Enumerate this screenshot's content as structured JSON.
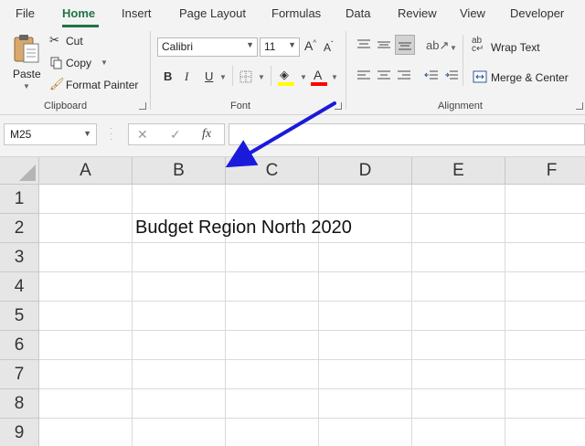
{
  "tabs": [
    {
      "label": "File",
      "active": false
    },
    {
      "label": "Home",
      "active": true
    },
    {
      "label": "Insert",
      "active": false
    },
    {
      "label": "Page Layout",
      "active": false
    },
    {
      "label": "Formulas",
      "active": false
    },
    {
      "label": "Data",
      "active": false
    },
    {
      "label": "Review",
      "active": false
    },
    {
      "label": "View",
      "active": false
    },
    {
      "label": "Developer",
      "active": false
    }
  ],
  "clipboard": {
    "paste": "Paste",
    "cut": "Cut",
    "copy": "Copy",
    "format_painter": "Format Painter",
    "group_label": "Clipboard"
  },
  "font": {
    "name": "Calibri",
    "size": "11",
    "bold": "B",
    "italic": "I",
    "underline": "U",
    "font_color_letter": "A",
    "grow": "A",
    "shrink": "A",
    "group_label": "Font",
    "fill_color": "#ffff00",
    "font_color": "#ff0000"
  },
  "alignment": {
    "wrap_text": "Wrap Text",
    "merge_center": "Merge & Center",
    "group_label": "Alignment"
  },
  "formula_bar": {
    "name_box": "M25",
    "fx": "fx",
    "cancel": "✕",
    "enter": "✓",
    "value": ""
  },
  "grid": {
    "columns": [
      "A",
      "B",
      "C",
      "D",
      "E",
      "F"
    ],
    "rows": [
      "1",
      "2",
      "3",
      "4",
      "5",
      "6",
      "7",
      "8",
      "9"
    ],
    "cells": {
      "B2": "Budget Region North 2020"
    }
  },
  "colors": {
    "accent": "#217346",
    "arrow": "#1a1adb"
  }
}
